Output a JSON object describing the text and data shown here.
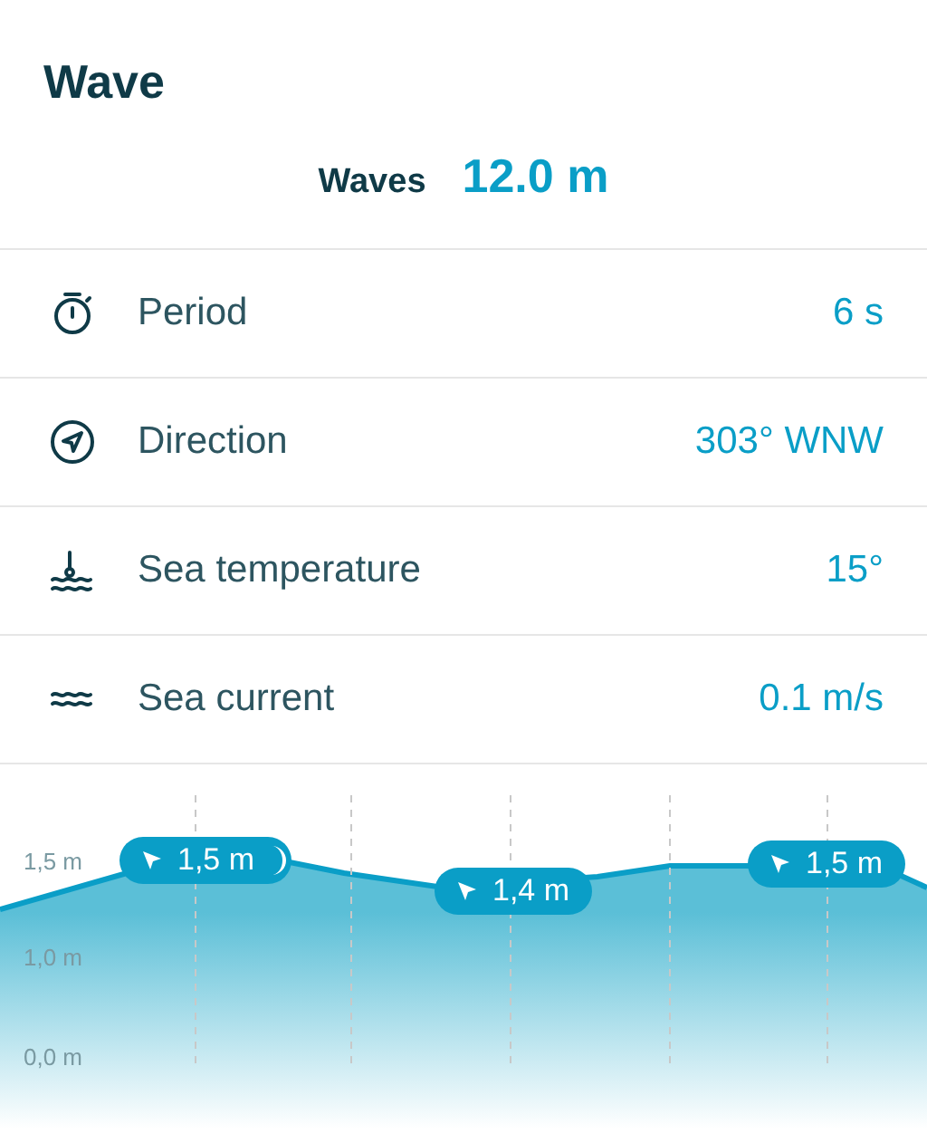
{
  "title": "Wave",
  "summary": {
    "label": "Waves",
    "value": "12.0 m"
  },
  "rows": [
    {
      "kind": "period",
      "label": "Period",
      "value": "6 s"
    },
    {
      "kind": "direction",
      "label": "Direction",
      "value": "303° WNW"
    },
    {
      "kind": "temperature",
      "label": "Sea temperature",
      "value": "15°"
    },
    {
      "kind": "current",
      "label": "Sea current",
      "value": "0.1 m/s"
    }
  ],
  "chart": {
    "y_labels": [
      "1,5 m",
      "1,0 m",
      "0,0 m"
    ],
    "badges": [
      {
        "label": "1,5 m",
        "night": true
      },
      {
        "label": "1,4 m",
        "night": false
      },
      {
        "label": "1,5 m",
        "night": false
      }
    ]
  }
}
